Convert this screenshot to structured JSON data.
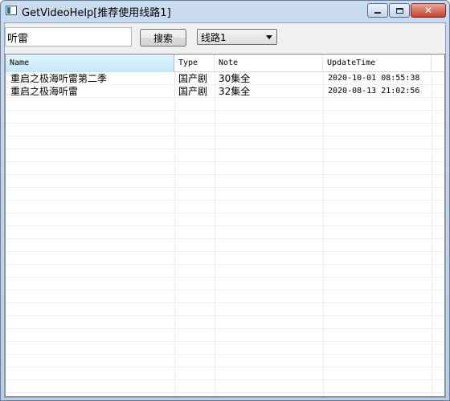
{
  "window": {
    "title": "GetVideoHelp[推荐使用线路1]"
  },
  "search": {
    "value": "听雷",
    "button_label": "搜索"
  },
  "route": {
    "selected": "线路1"
  },
  "table": {
    "columns": [
      "Name",
      "Type",
      "Note",
      "UpdateTime"
    ],
    "rows": [
      {
        "name": "重启之极海听雷第二季",
        "type": "国产剧",
        "note": "30集全",
        "update_time": "2020-10-01 08:55:38"
      },
      {
        "name": "重启之极海听雷",
        "type": "国产剧",
        "note": "32集全",
        "update_time": "2020-08-13 21:02:56"
      }
    ]
  }
}
